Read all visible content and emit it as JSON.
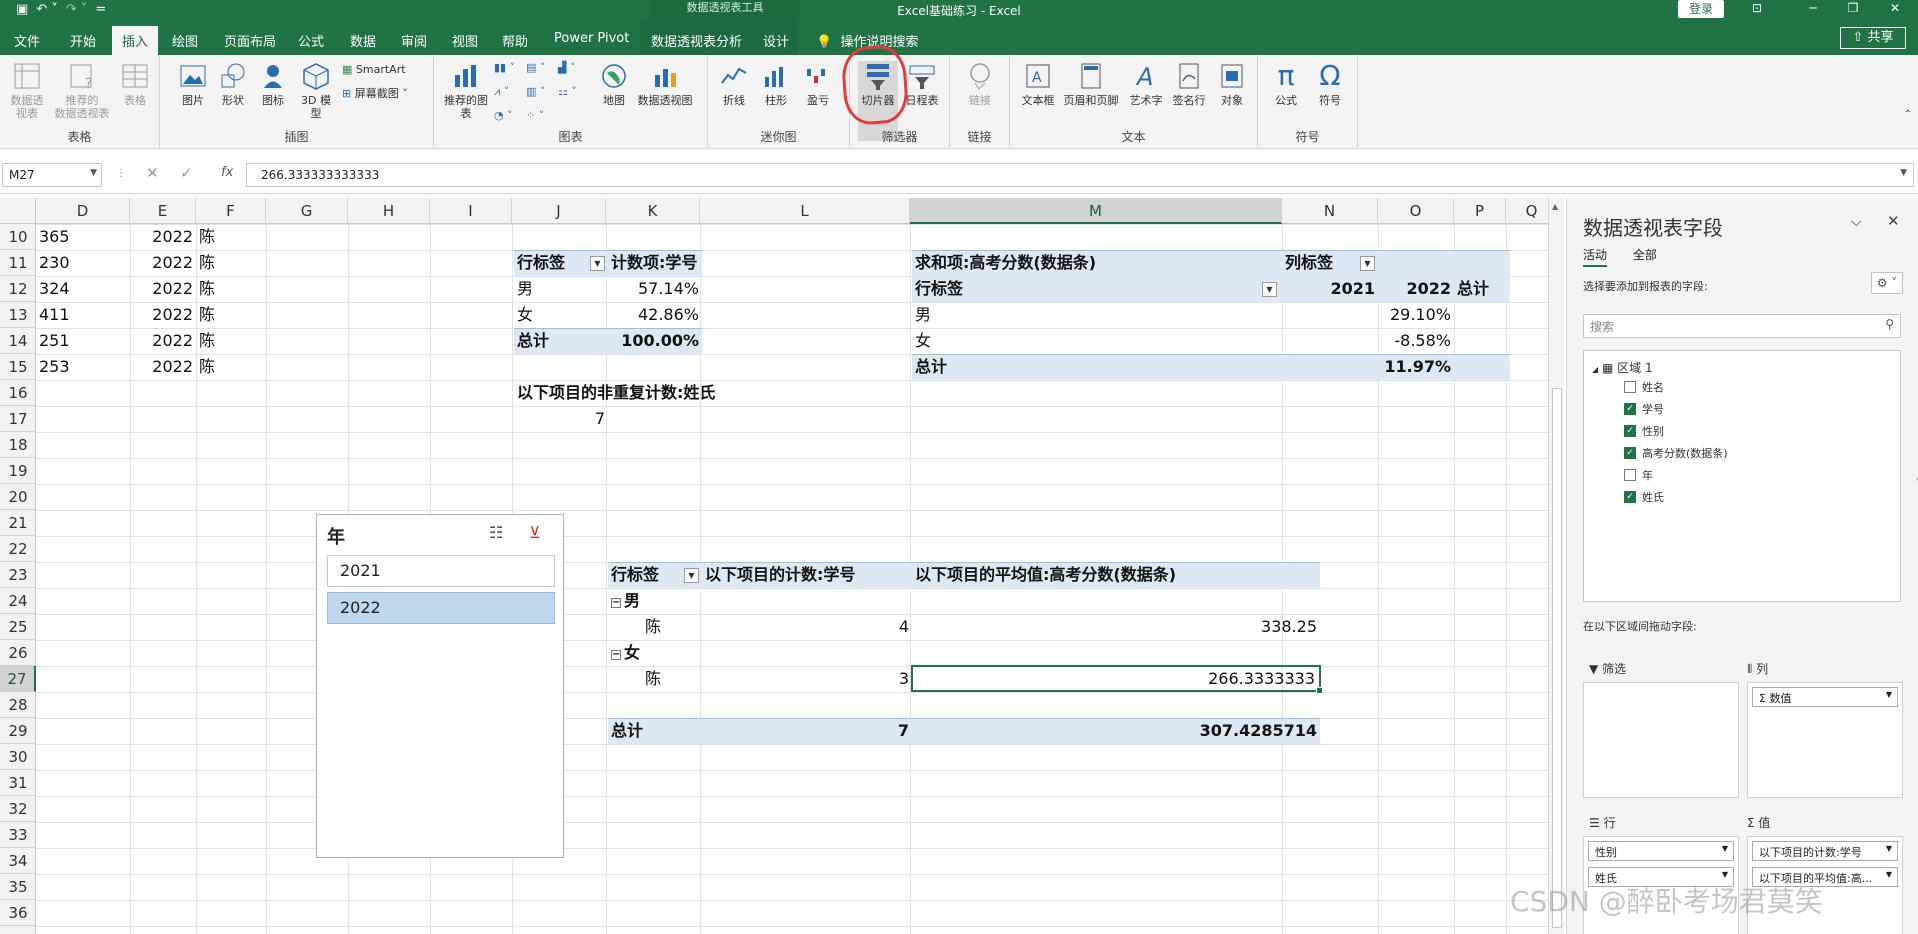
{
  "titlebar": {
    "context_label": "数据透视表工具",
    "title": "Excel基础练习  -  Excel",
    "login": "登录",
    "customize": "="
  },
  "tabs": [
    {
      "label": "文件"
    },
    {
      "label": "开始"
    },
    {
      "label": "插入"
    },
    {
      "label": "绘图"
    },
    {
      "label": "页面布局"
    },
    {
      "label": "公式"
    },
    {
      "label": "数据"
    },
    {
      "label": "审阅"
    },
    {
      "label": "视图"
    },
    {
      "label": "帮助"
    },
    {
      "label": "Power Pivot"
    },
    {
      "label": "数据透视表分析"
    },
    {
      "label": "设计"
    },
    {
      "label": "操作说明搜索"
    }
  ],
  "share": "共享",
  "ribbon": {
    "groups": [
      {
        "label": "表格"
      },
      {
        "label": "插图"
      },
      {
        "label": "图表"
      },
      {
        "label": "迷你图"
      },
      {
        "label": "筛选器"
      },
      {
        "label": "链接"
      },
      {
        "label": "文本"
      },
      {
        "label": "符号"
      }
    ],
    "buttons": {
      "pivot": "数据透视表",
      "pivot_line2": "视表 ˅",
      "rec_pivot": "推荐的",
      "rec_pivot_line2": "数据透视表",
      "table": "表格",
      "picture": "图片",
      "shapes": "形状",
      "icons": "图标",
      "model3d": "3D 模型",
      "smartart": "SmartArt",
      "screenshot": "屏幕截图",
      "rec_charts": "推荐的图表",
      "maps": "地图",
      "pivot_chart": "数据透视图",
      "spark_line": "折线",
      "spark_column": "柱形",
      "spark_winloss": "盈亏",
      "slicer": "切片器",
      "timeline": "日程表",
      "link": "链接",
      "textbox": "文本框",
      "header_footer": "页眉和页脚",
      "wordart": "艺术字",
      "signature": "签名行",
      "object": "对象",
      "equation": "公式",
      "symbol": "符号"
    }
  },
  "formula_bar": {
    "name_box": "M27",
    "formula": "266.333333333333"
  },
  "columns": [
    "D",
    "E",
    "F",
    "G",
    "H",
    "I",
    "J",
    "K",
    "L",
    "M",
    "N",
    "O",
    "P",
    "Q"
  ],
  "selected_column": "M",
  "rows": [
    "10",
    "11",
    "12",
    "13",
    "14",
    "15",
    "16",
    "17",
    "18",
    "19",
    "20",
    "21",
    "22",
    "23",
    "24",
    "25",
    "26",
    "27",
    "28",
    "29",
    "30",
    "31",
    "32",
    "33",
    "34",
    "35",
    "36"
  ],
  "selected_row": "27",
  "data_rows": [
    {
      "d": "365",
      "e": "2022",
      "f": "陈"
    },
    {
      "d": "230",
      "e": "2022",
      "f": "陈"
    },
    {
      "d": "324",
      "e": "2022",
      "f": "陈"
    },
    {
      "d": "411",
      "e": "2022",
      "f": "陈"
    },
    {
      "d": "251",
      "e": "2022",
      "f": "陈"
    },
    {
      "d": "253",
      "e": "2022",
      "f": "陈"
    }
  ],
  "pivot1": {
    "row_label": "行标签",
    "value_header": "计数项:学号",
    "rows": [
      {
        "label": "男",
        "value": "57.14%"
      },
      {
        "label": "女",
        "value": "42.86%"
      }
    ],
    "total_label": "总计",
    "total_value": "100.00%",
    "distinct_header": "以下项目的非重复计数:姓氏",
    "distinct_value": "7"
  },
  "pivot2": {
    "value_header": "求和项:高考分数(数据条)",
    "col_label": "列标签",
    "row_label": "行标签",
    "col_2021": "2021",
    "col_2022": "2022",
    "col_total": "总计",
    "rows": [
      {
        "label": "男",
        "value": "29.10%"
      },
      {
        "label": "女",
        "value": "-8.58%"
      }
    ],
    "total_label": "总计",
    "total_value": "11.97%"
  },
  "pivot3": {
    "row_label": "行标签",
    "count_header": "以下项目的计数:学号",
    "avg_header": "以下项目的平均值:高考分数(数据条)",
    "group_male": "男",
    "male_name": "陈",
    "male_count": "4",
    "male_avg": "338.25",
    "group_female": "女",
    "female_name": "陈",
    "female_count": "3",
    "female_avg": "266.3333333",
    "total_label": "总计",
    "total_count": "7",
    "total_avg": "307.4285714"
  },
  "slicer": {
    "title": "年",
    "items": [
      {
        "label": "2021",
        "selected": false
      },
      {
        "label": "2022",
        "selected": true
      }
    ]
  },
  "pane": {
    "title": "数据透视表字段",
    "tab_active": "活动",
    "tab_all": "全部",
    "hint": "选择要添加到报表的字段:",
    "search_placeholder": "搜索",
    "area_name": "区域 1",
    "fields": [
      {
        "label": "姓名",
        "checked": false
      },
      {
        "label": "学号",
        "checked": true
      },
      {
        "label": "性别",
        "checked": true
      },
      {
        "label": "高考分数(数据条)",
        "checked": true
      },
      {
        "label": "年",
        "checked": false
      },
      {
        "label": "姓氏",
        "checked": true
      }
    ],
    "drag_hint": "在以下区域间拖动字段:",
    "filter_label": "筛选",
    "columns_label": "列",
    "rows_label": "行",
    "values_label": "值",
    "columns_chip": "Σ 数值",
    "rows_chips": [
      "性别",
      "姓氏"
    ],
    "values_chips": [
      "以下项目的计数:学号",
      "以下项目的平均值:高..."
    ]
  },
  "watermark": "CSDN @醉卧考场君莫笑"
}
